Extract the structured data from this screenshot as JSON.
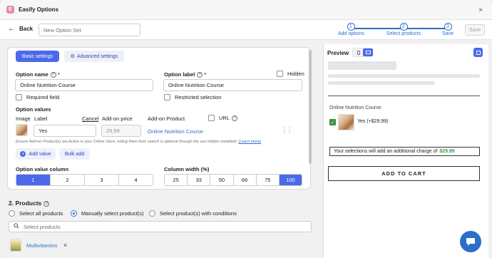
{
  "app": {
    "icon_letter": "E",
    "title": "Easify Options",
    "close": "×"
  },
  "toolbar": {
    "back_label": "Back",
    "option_set_placeholder": "New Option Set",
    "steps": [
      {
        "num": "1",
        "label": "Add options"
      },
      {
        "num": "2",
        "label": "Select products"
      },
      {
        "num": "3",
        "label": "Save"
      }
    ],
    "save_label": "Save"
  },
  "tabs": {
    "basic": "Basic settings",
    "advanced": "Advanced settings"
  },
  "option": {
    "name_label": "Option name",
    "name_value": "Online Nutrition Course",
    "label_label": "Option label",
    "label_value": "Online Nutrition Course",
    "hidden_label": "Hidden",
    "required_label": "Required field",
    "restricted_label": "Restricted selection"
  },
  "values": {
    "heading": "Option values",
    "col_image": "Image",
    "col_label": "Label",
    "cancel": "Cancel",
    "col_price": "Add-on price",
    "col_product": "Add-on Product",
    "url_label": "URL",
    "row_label": "Yes",
    "row_price": "29,99",
    "row_product": "Online Nutrition Course",
    "note": "Ensure Add-on Product(s) are Active in your Online Store; hiding them from search is optional through the seo hidden metafield.",
    "note_link": "(Learn more)",
    "add_value": "Add value",
    "bulk_add": "Bulk add"
  },
  "columns": {
    "label": "Option value column",
    "options": [
      "1",
      "2",
      "3",
      "4"
    ],
    "selected": "1"
  },
  "width": {
    "label": "Column width (%)",
    "options": [
      "25",
      "33",
      "50",
      "66",
      "75",
      "100"
    ],
    "selected": "100"
  },
  "products": {
    "heading": "2. Products",
    "radios": [
      "Select all products",
      "Manually select product(s)",
      "Select product(s) with conditions"
    ],
    "selected_index": 1,
    "search_placeholder": "Select products",
    "items": [
      {
        "name": "Multivitamins"
      }
    ]
  },
  "preview": {
    "title": "Preview",
    "option_title": "Online Nutrition Course",
    "option_value": "Yes (+$29.99)",
    "charge_text": "Your selections will add an additional charge of",
    "charge_amount": "$29.99",
    "add_to_cart": "ADD TO CART"
  },
  "colors": {
    "accent": "#4b6ae9",
    "link": "#2c6ecb",
    "price_green": "#2e9a4a",
    "chat": "#2c6ecb"
  }
}
